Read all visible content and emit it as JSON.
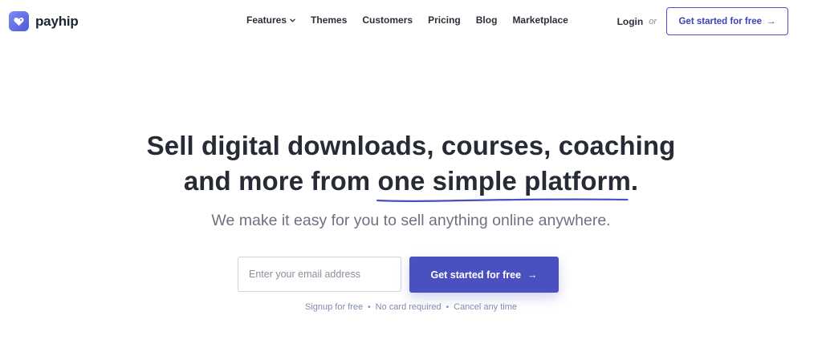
{
  "header": {
    "brand": "payhip",
    "nav": [
      {
        "label": "Features",
        "has_dropdown": true
      },
      {
        "label": "Themes"
      },
      {
        "label": "Customers"
      },
      {
        "label": "Pricing"
      },
      {
        "label": "Blog"
      },
      {
        "label": "Marketplace"
      }
    ],
    "login_label": "Login",
    "or_label": "or",
    "cta_label": "Get started for free",
    "cta_arrow": "→"
  },
  "hero": {
    "headline_line1": "Sell digital downloads, courses, coaching",
    "headline_line2_prefix": "and more from ",
    "headline_highlight": "one simple platform",
    "headline_line2_suffix": ".",
    "subhead": "We make it easy for you to sell anything online anywhere.",
    "email_placeholder": "Enter your email address",
    "email_value": "",
    "cta_label": "Get started for free",
    "cta_arrow": "→",
    "notes": [
      "Signup for free",
      "No card required",
      "Cancel any time"
    ],
    "note_separator": "•"
  },
  "colors": {
    "brand_primary": "#4a50bf",
    "underline": "#4a50bf",
    "text_dark": "#272b36",
    "text_muted": "#6e7280",
    "notes": "#7f8bb0"
  }
}
